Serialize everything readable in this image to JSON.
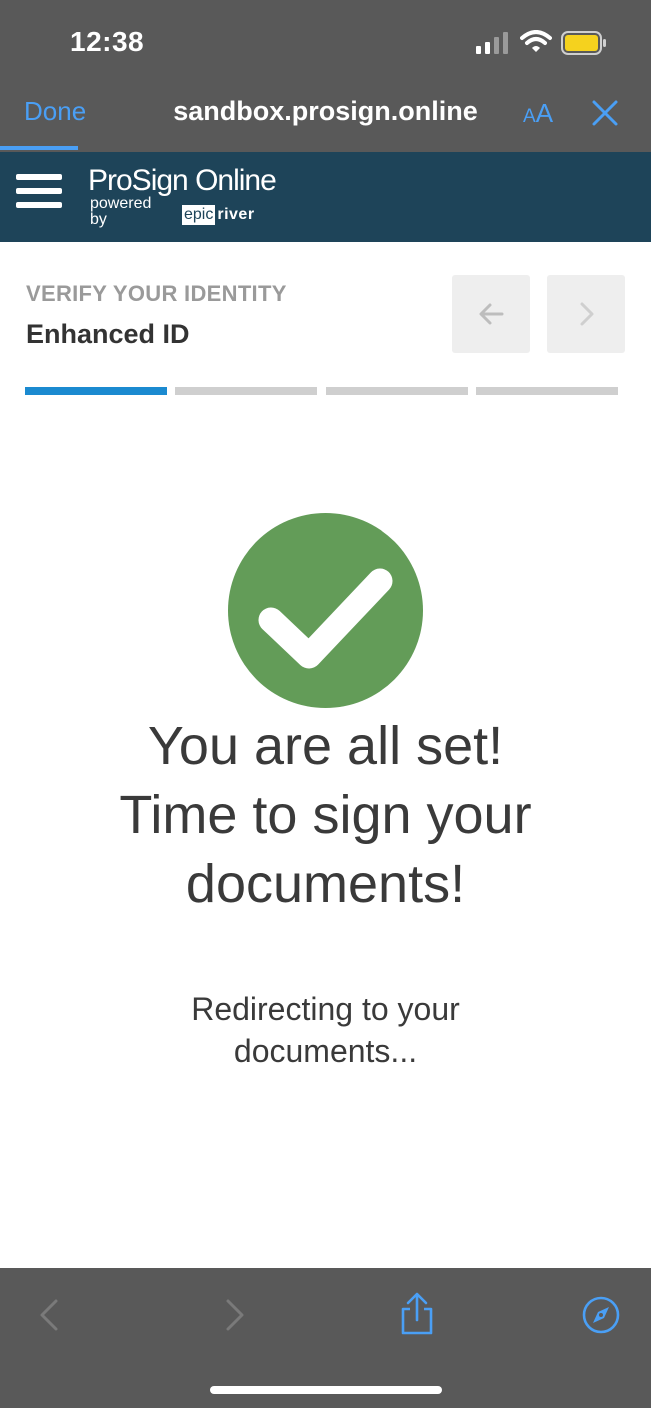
{
  "status_bar": {
    "time": "12:38",
    "icons": [
      "signal-icon",
      "wifi-icon",
      "battery-icon"
    ],
    "battery_color": "#f5d21e"
  },
  "browser": {
    "done_label": "Done",
    "url": "sandbox.prosign.online",
    "text_size_label_small": "A",
    "text_size_label_large": "A",
    "accent_color": "#4a9ff5"
  },
  "app_header": {
    "brand": "ProSign Online",
    "powered_by": "powered by",
    "epic": "epic",
    "river": "river",
    "background": "#1e4459"
  },
  "step": {
    "eyebrow": "VERIFY YOUR IDENTITY",
    "title": "Enhanced ID",
    "progress": {
      "total_steps": 4,
      "current_step": 1,
      "active_color": "#1b8ad0"
    }
  },
  "success": {
    "icon": "checkmark-icon",
    "icon_color": "#639c58",
    "message_lines": [
      "You are all set!",
      "Time to sign your",
      "documents!"
    ],
    "redirect_lines": [
      "Redirecting to your",
      "documents..."
    ]
  },
  "toolbar": {
    "icons": [
      "back-icon",
      "forward-icon",
      "share-icon",
      "safari-compass-icon"
    ]
  }
}
